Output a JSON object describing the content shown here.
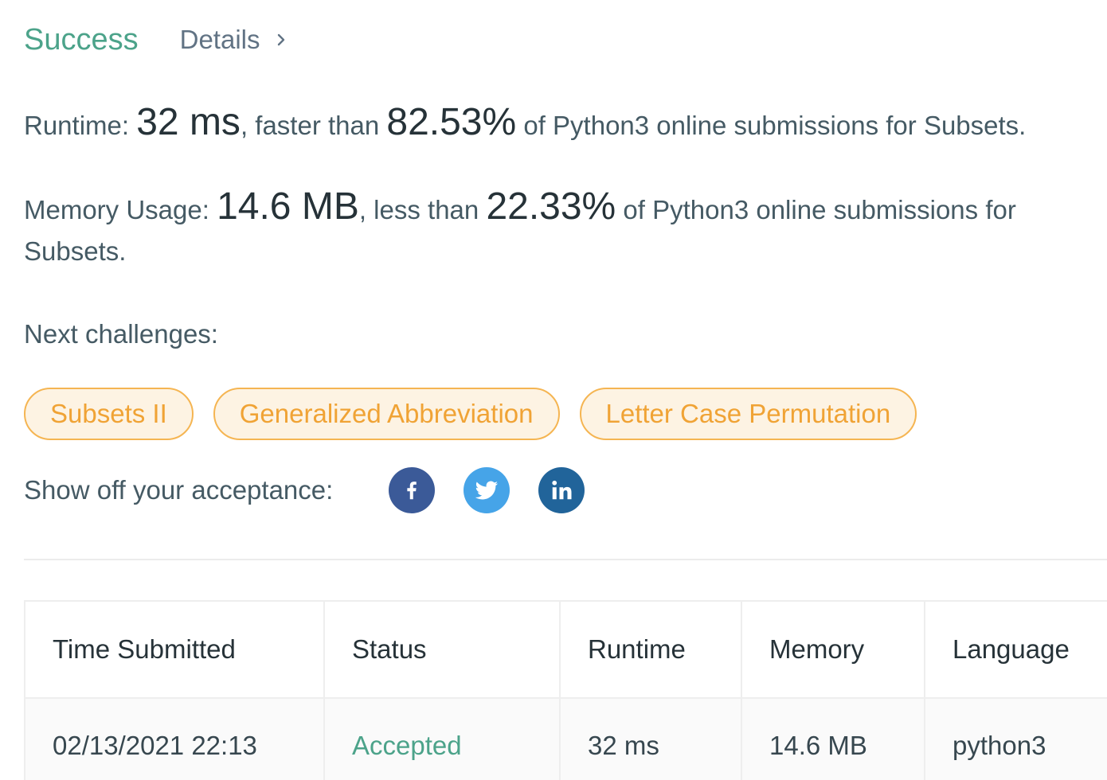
{
  "header": {
    "status": "Success",
    "details_label": "Details"
  },
  "runtime": {
    "label": "Runtime: ",
    "value": "32 ms",
    "mid_text": ", faster than ",
    "percent": "82.53%",
    "tail_text": " of Python3 online submissions for Subsets."
  },
  "memory": {
    "label": "Memory Usage: ",
    "value": "14.6 MB",
    "mid_text": ", less than ",
    "percent": "22.33%",
    "tail_text": " of Python3 online submissions for Subsets."
  },
  "next_challenges": {
    "label": "Next challenges:",
    "items": [
      "Subsets II",
      "Generalized Abbreviation",
      "Letter Case Permutation"
    ]
  },
  "share": {
    "label": "Show off your acceptance:",
    "icons": [
      "facebook-icon",
      "twitter-icon",
      "linkedin-icon"
    ],
    "colors": {
      "facebook": "#3b5a98",
      "twitter": "#46a4e8",
      "linkedin": "#21649a"
    }
  },
  "table": {
    "headers": [
      "Time Submitted",
      "Status",
      "Runtime",
      "Memory",
      "Language"
    ],
    "rows": [
      [
        "02/13/2021 22:13",
        "Accepted",
        "32 ms",
        "14.6 MB",
        "python3"
      ]
    ]
  },
  "colors": {
    "success": "#4ca38a",
    "chip_border": "#f5b552",
    "chip_text": "#f0a335",
    "chip_bg": "#fdf3e3"
  }
}
